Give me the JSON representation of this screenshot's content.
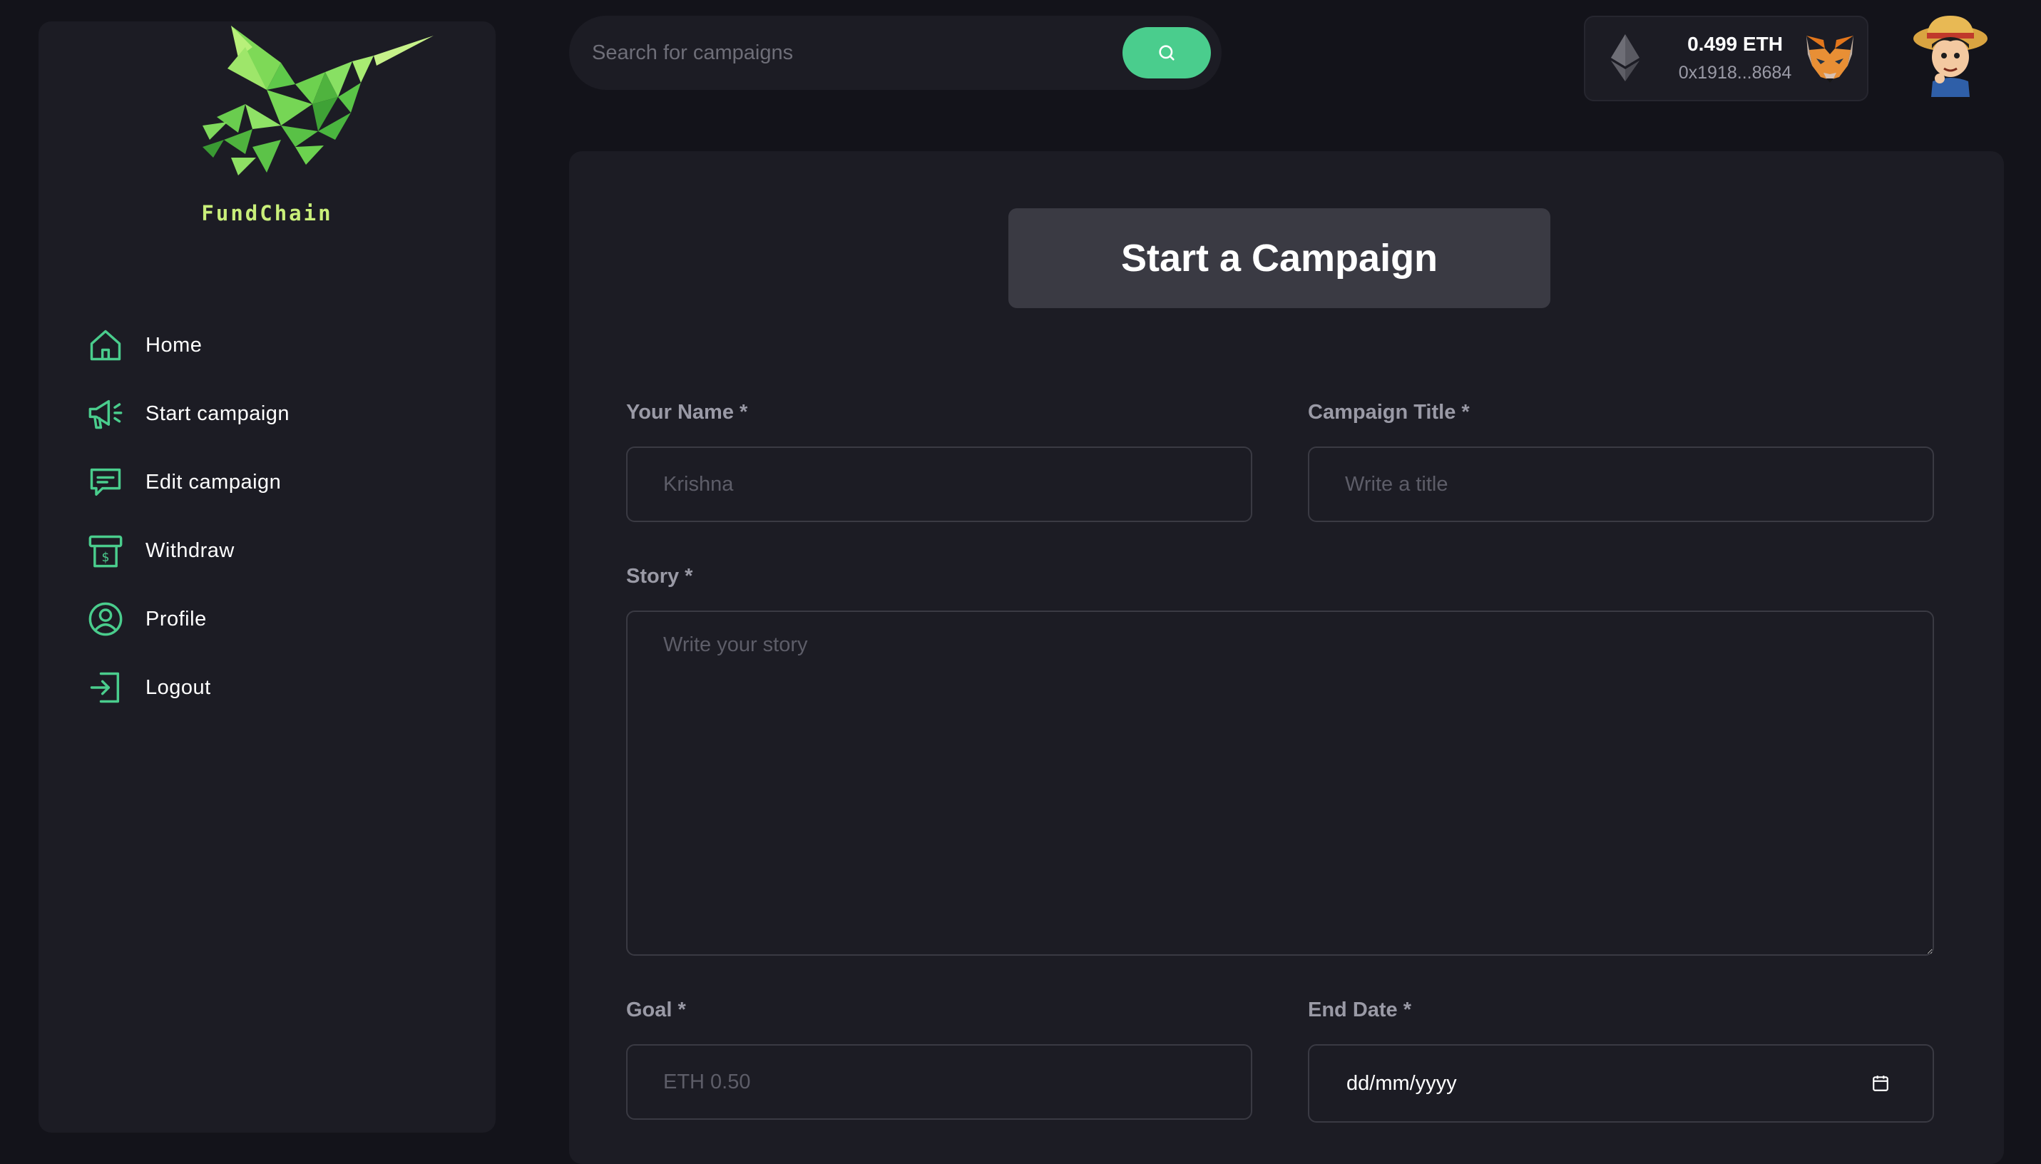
{
  "brand": {
    "name": "FundChain"
  },
  "sidebar": {
    "items": [
      {
        "label": "Home",
        "icon": "home-icon"
      },
      {
        "label": "Start campaign",
        "icon": "megaphone-icon"
      },
      {
        "label": "Edit campaign",
        "icon": "message-icon"
      },
      {
        "label": "Withdraw",
        "icon": "withdraw-icon"
      },
      {
        "label": "Profile",
        "icon": "profile-icon"
      },
      {
        "label": "Logout",
        "icon": "logout-icon"
      }
    ]
  },
  "search": {
    "placeholder": "Search for campaigns",
    "button_icon": "search-icon"
  },
  "wallet": {
    "balance": "0.499 ETH",
    "address": "0x1918...8684"
  },
  "form": {
    "title": "Start a Campaign",
    "name_label": "Your Name *",
    "name_placeholder": "Krishna",
    "campaign_title_label": "Campaign Title *",
    "campaign_title_placeholder": "Write a title",
    "story_label": "Story *",
    "story_placeholder": "Write your story",
    "goal_label": "Goal *",
    "goal_placeholder": "ETH 0.50",
    "end_date_label": "End Date *",
    "end_date_value": "dd/mm/yyyy"
  },
  "colors": {
    "accent": "#4acd8d",
    "background": "#13131a",
    "panel": "#1c1c24",
    "heading_box": "#3a3a43",
    "label": "#9a9aa6"
  }
}
